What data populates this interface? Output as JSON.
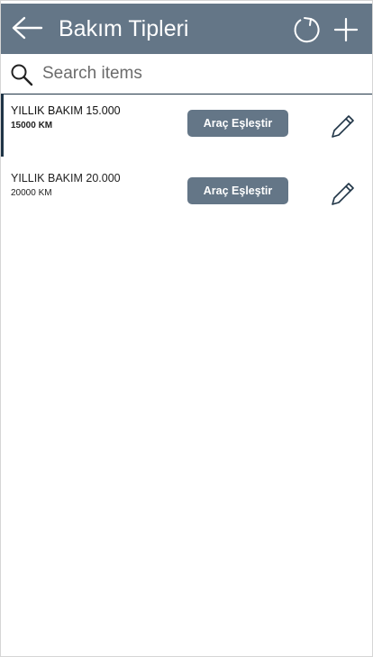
{
  "header": {
    "title": "Bakım Tipleri",
    "back_icon": "arrow-left-icon",
    "refresh_icon": "refresh-icon",
    "add_icon": "plus-icon"
  },
  "search": {
    "placeholder": "Search items",
    "value": ""
  },
  "items": [
    {
      "name": "YILLIK BAKIM 15.000",
      "km": "15000 KM",
      "button_label": "Araç Eşleştir",
      "selected": true
    },
    {
      "name": "YILLIK BAKIM 20.000",
      "km": "20000 KM",
      "button_label": "Araç Eşleştir",
      "selected": false
    }
  ],
  "colors": {
    "header_bg": "#647687",
    "button_bg": "#647687",
    "accent_dark": "#1f3446"
  }
}
